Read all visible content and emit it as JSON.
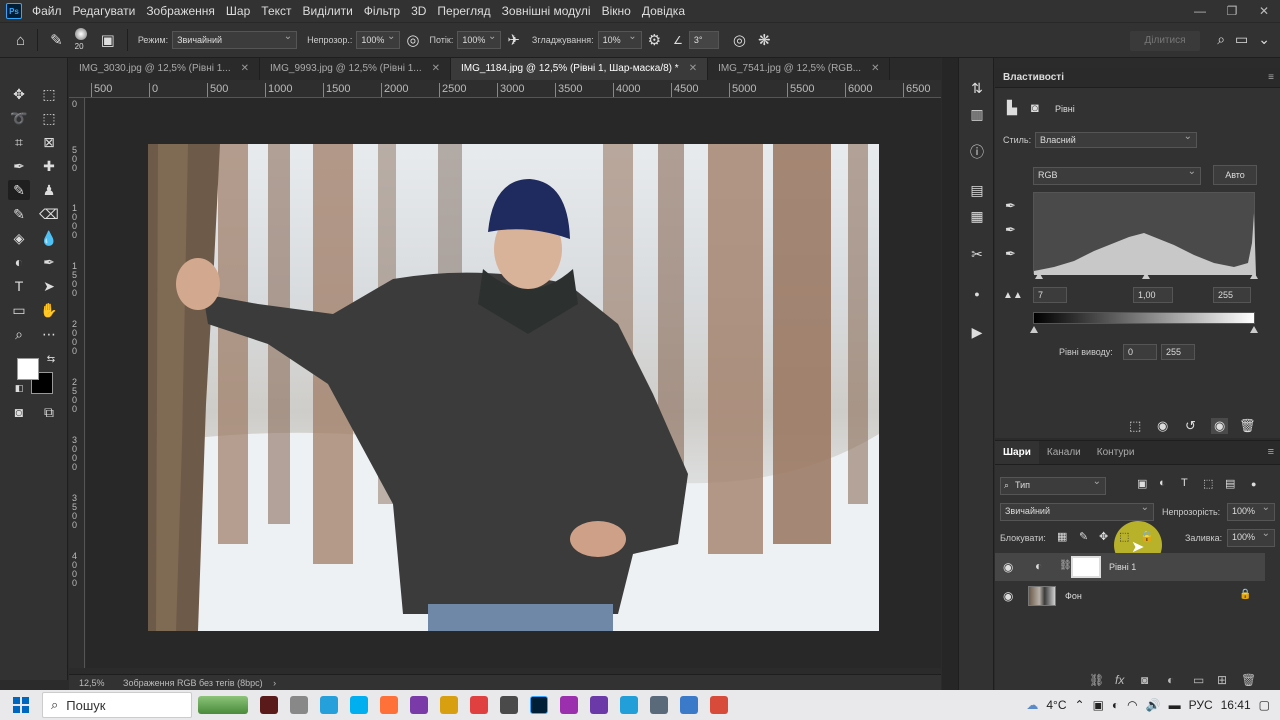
{
  "app": {
    "logo": "Ps"
  },
  "menu": [
    "Файл",
    "Редагувати",
    "Зображення",
    "Шар",
    "Текст",
    "Виділити",
    "Фільтр",
    "3D",
    "Перегляд",
    "Зовнішні модулі",
    "Вікно",
    "Довідка"
  ],
  "options": {
    "brush_size": "20",
    "mode_label": "Режим:",
    "mode_value": "Звичайний",
    "opacity_label": "Непрозор.:",
    "opacity_value": "100%",
    "flow_label": "Потік:",
    "flow_value": "100%",
    "smoothing_label": "Згладжування:",
    "smoothing_value": "10%",
    "angle_value": "3°",
    "share_label": "Ділитися"
  },
  "tabs": [
    {
      "label": "IMG_3030.jpg @ 12,5% (Рівні 1...",
      "active": false
    },
    {
      "label": "IMG_9993.jpg @ 12,5% (Рівні 1...",
      "active": false
    },
    {
      "label": "IMG_1184.jpg @ 12,5% (Рівні 1, Шар-маска/8) *",
      "active": true
    },
    {
      "label": "IMG_7541.jpg @ 12,5% (RGB...",
      "active": false
    }
  ],
  "ruler": {
    "top": [
      "500",
      "0",
      "500",
      "1000",
      "1500",
      "2000",
      "2500",
      "3000",
      "3500",
      "4000",
      "4500",
      "5000",
      "5500",
      "6000",
      "6500"
    ],
    "left": [
      "0",
      "5 0 0",
      "1 0 0 0",
      "1 5 0 0",
      "2 0 0 0",
      "2 5 0 0",
      "3 0 0 0",
      "3 5 0 0",
      "4 0 0 0"
    ]
  },
  "status": {
    "zoom": "12,5%",
    "info": "Зображення RGB без тегів (8bpc)"
  },
  "properties": {
    "title": "Властивості",
    "adjustment_name": "Рівні",
    "preset_label": "Стиль:",
    "preset_value": "Власний",
    "channel_value": "RGB",
    "auto_label": "Авто",
    "input_black": "7",
    "input_gamma": "1,00",
    "input_white": "255",
    "output_label": "Рівні виводу:",
    "output_black": "0",
    "output_white": "255"
  },
  "layers": {
    "tabs": [
      "Шари",
      "Канали",
      "Контури"
    ],
    "filter_label": "Тип",
    "blend_mode": "Звичайний",
    "opacity_label": "Непрозорість:",
    "opacity_value": "100%",
    "lock_label": "Блокувати:",
    "fill_label": "Заливка:",
    "fill_value": "100%",
    "items": [
      {
        "name": "Рівні 1",
        "selected": true
      },
      {
        "name": "Фон",
        "selected": false
      }
    ]
  },
  "taskbar": {
    "search_placeholder": "Пошук",
    "weather": "4°C",
    "language": "РУС",
    "time": "16:41"
  }
}
